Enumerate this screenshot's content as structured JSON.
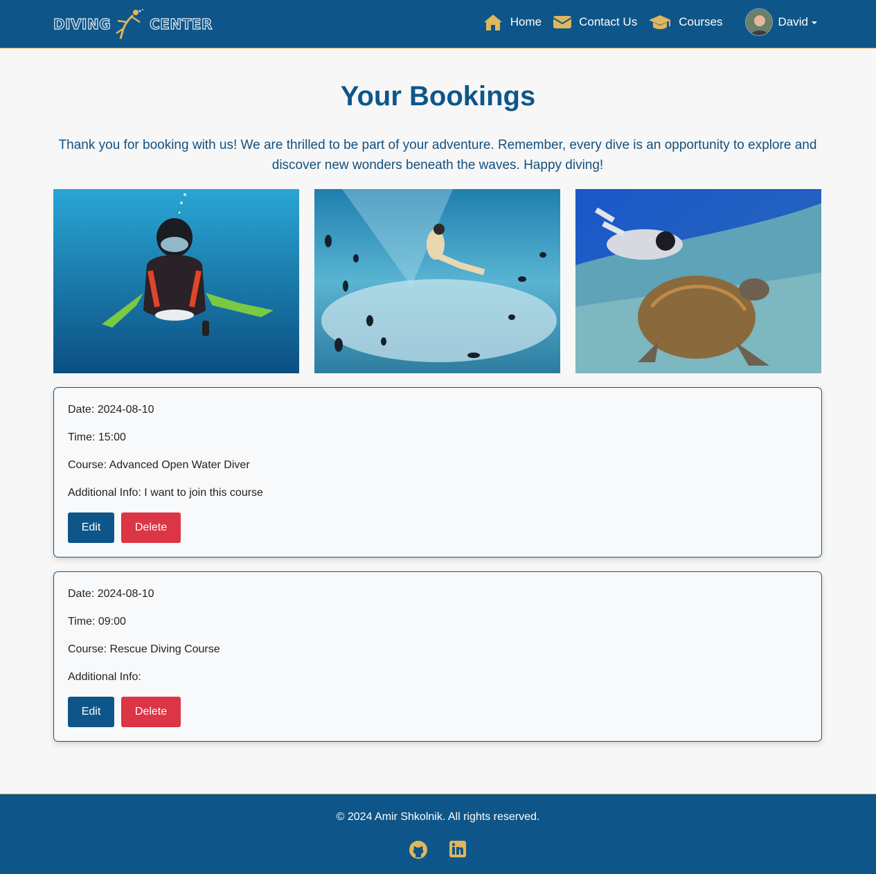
{
  "nav": {
    "logo_left": "DIVING",
    "logo_right": "CENTER",
    "links": [
      {
        "label": "Home",
        "icon": "home-icon"
      },
      {
        "label": "Contact Us",
        "icon": "envelope-icon"
      },
      {
        "label": "Courses",
        "icon": "graduation-cap-icon"
      }
    ],
    "user_name": "David"
  },
  "page": {
    "title": "Your Bookings",
    "intro": "Thank you for booking with us! We are thrilled to be part of your adventure. Remember, every dive is an opportunity to explore and discover new wonders beneath the waves. Happy diving!"
  },
  "gallery": [
    {
      "subject": "scuba-diver-photo"
    },
    {
      "subject": "snorkeler-photo"
    },
    {
      "subject": "diver-with-turtle-photo"
    }
  ],
  "bookings": [
    {
      "date": "Date: 2024-08-10",
      "time": "Time: 15:00",
      "course": "Course: Advanced Open Water Diver",
      "info": "Additional Info: I want to join this course",
      "edit_label": "Edit",
      "delete_label": "Delete"
    },
    {
      "date": "Date: 2024-08-10",
      "time": "Time: 09:00",
      "course": "Course: Rescue Diving Course",
      "info": "Additional Info:",
      "edit_label": "Edit",
      "delete_label": "Delete"
    }
  ],
  "footer": {
    "copyright": "© 2024 Amir Shkolnik. All rights reserved.",
    "social": [
      "github-icon",
      "linkedin-icon"
    ]
  },
  "colors": {
    "primary": "#0e5689",
    "accent": "#c9a85a",
    "danger": "#dc3545",
    "background": "#f7f7f7"
  }
}
